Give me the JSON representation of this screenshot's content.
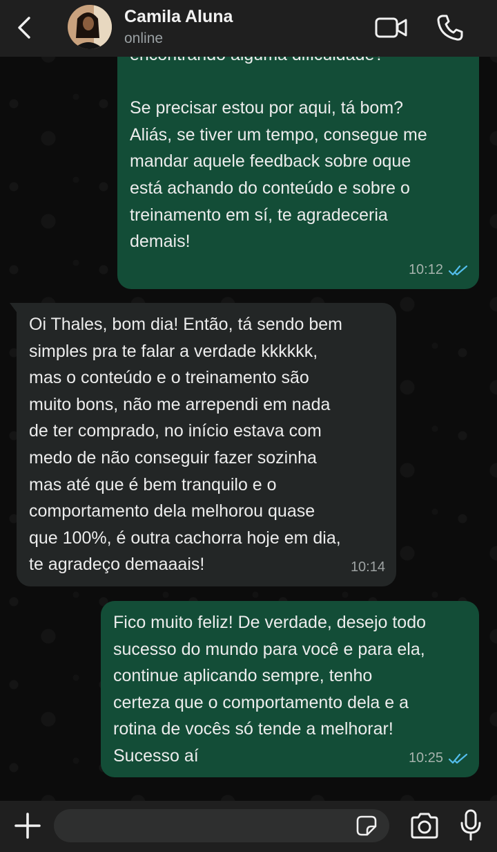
{
  "header": {
    "contact_name": "Camila Aluna",
    "status": "online",
    "icons": [
      "back-arrow",
      "video-call",
      "voice-call"
    ]
  },
  "messages": [
    {
      "direction": "outgoing",
      "text": "encontrando alguma dificuldade?\n\nSe precisar estou por aqui, tá bom?\nAliás, se tiver um tempo, consegue me\nmandar aquele feedback sobre oque\nestá achando do conteúdo e sobre o\ntreinamento em sí, te agradeceria\ndemais!",
      "time": "10:12",
      "status": "read"
    },
    {
      "direction": "incoming",
      "text": "Oi Thales, bom dia! Então, tá sendo bem\nsimples pra te falar a verdade kkkkkk,\nmas o conteúdo e o treinamento são\nmuito bons, não me arrependi em nada\nde ter comprado, no início estava com\nmedo de não conseguir fazer sozinha\nmas até que é bem tranquilo e o\ncomportamento dela melhorou quase\nque 100%, é outra cachorra hoje em dia,\nte agradeço demaaais!",
      "time": "10:14"
    },
    {
      "direction": "outgoing",
      "text": "Fico muito feliz! De verdade, desejo todo\nsucesso do mundo para você e para ela,\ncontinue aplicando sempre, tenho\ncerteza que o comportamento dela e a\nrotina de vocês só tende a melhorar!\nSucesso aí",
      "time": "10:25",
      "status": "read"
    }
  ],
  "footer": {
    "input_value": "",
    "icons": [
      "plus",
      "sticker",
      "camera",
      "microphone"
    ]
  },
  "colors": {
    "outgoing_bubble": "#134d37",
    "incoming_bubble": "#232626",
    "header_bg": "#1f1f1f",
    "read_ticks": "#53bdeb"
  }
}
